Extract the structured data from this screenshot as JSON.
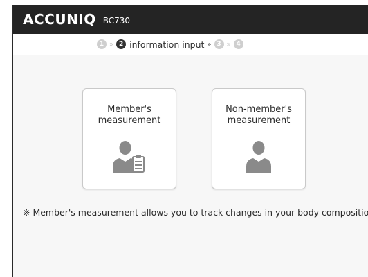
{
  "header": {
    "brand": "ACCUNIQ",
    "model": "BC730"
  },
  "steps": {
    "items": [
      {
        "number": "1",
        "state": "inactive"
      },
      {
        "number": "2",
        "state": "active",
        "label": "information input"
      },
      {
        "number": "3",
        "state": "inactive"
      },
      {
        "number": "4",
        "state": "inactive"
      }
    ],
    "separator": "»"
  },
  "cards": {
    "member": {
      "line1": "Member's",
      "line2": "measurement",
      "icon": "member-clipboard-icon"
    },
    "nonmember": {
      "line1": "Non-member's",
      "line2": "measurement",
      "icon": "person-icon"
    }
  },
  "note": "※ Member's measurement allows you to track changes in your body composition",
  "colors": {
    "header_bg": "#242424",
    "icon_gray": "#8a8a8a",
    "active_step": "#333333",
    "inactive_step": "#cfcfcf"
  }
}
